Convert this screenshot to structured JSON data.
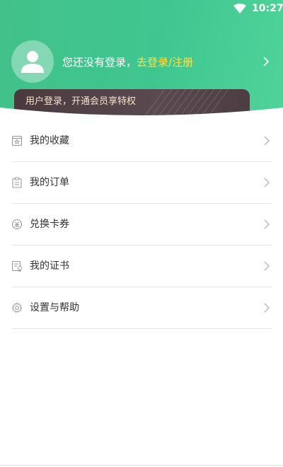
{
  "status_bar": {
    "time": "10:27",
    "wifi_icon": "wifi-icon"
  },
  "header": {
    "avatar_icon": "user-avatar-icon",
    "login_prompt": "您还没有登录，",
    "login_link": "去登录/注册",
    "chevron_icon": "chevron-right-icon",
    "colors": {
      "gradient_start": "#43c18a",
      "gradient_end": "#4fd39a",
      "link": "#ffe14a"
    }
  },
  "vip_banner": {
    "text": "用户登录，开通会员享特权",
    "colors": {
      "background": "#4a3a3e",
      "text": "#f5e3c9"
    }
  },
  "menu": {
    "items": [
      {
        "label": "我的收藏",
        "icon": "favorites-icon"
      },
      {
        "label": "我的订单",
        "icon": "orders-icon"
      },
      {
        "label": "兑换卡券",
        "icon": "coupon-exchange-icon"
      },
      {
        "label": "我的证书",
        "icon": "certificate-icon"
      },
      {
        "label": "设置与帮助",
        "icon": "settings-icon"
      }
    ]
  }
}
